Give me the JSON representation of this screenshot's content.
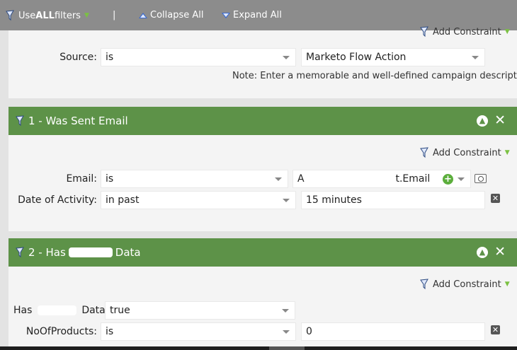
{
  "toolbar": {
    "use_all_prefix": "Use ",
    "use_all_bold": "ALL",
    "use_all_suffix": " filters",
    "separator": "|",
    "collapse_label": "Collapse All",
    "expand_label": "Expand All"
  },
  "top_panel": {
    "add_constraint_label": "Add Constraint",
    "source_label": "Source:",
    "source_operator": "is",
    "source_value": "Marketo Flow Action",
    "note": "Note: Enter a memorable and well-defined campaign description"
  },
  "filter_1": {
    "title": "1 - Was Sent Email",
    "add_constraint_label": "Add Constraint",
    "email_label": "Email:",
    "email_operator": "is",
    "email_value_start": "A",
    "email_value_end": "t.Email",
    "date_label": "Date of Activity:",
    "date_operator": "in past",
    "date_value": "15 minutes"
  },
  "filter_2": {
    "title_prefix": "2 - Has",
    "title_suffix": "Data",
    "add_constraint_label": "Add Constraint",
    "has_label_prefix": "Has",
    "has_label_suffix": "Data:",
    "has_value": "true",
    "products_label": "NoOfProducts:",
    "products_operator": "is",
    "products_value": "0"
  },
  "colors": {
    "toolbar_bg": "#8c8c8c",
    "header_bg": "#5d9248",
    "panel_bg": "#f4f4f4",
    "page_bg": "#e3e3e3"
  }
}
